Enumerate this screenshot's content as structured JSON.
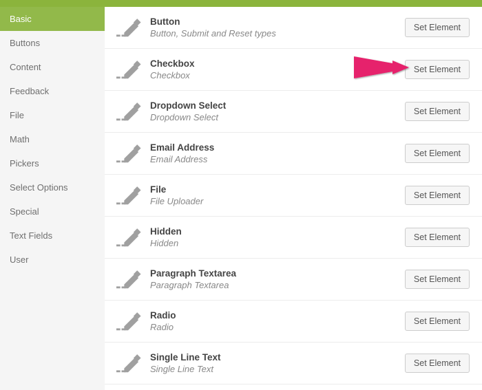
{
  "sidebar": {
    "items": [
      {
        "label": "Basic",
        "active": true
      },
      {
        "label": "Buttons",
        "active": false
      },
      {
        "label": "Content",
        "active": false
      },
      {
        "label": "Feedback",
        "active": false
      },
      {
        "label": "File",
        "active": false
      },
      {
        "label": "Math",
        "active": false
      },
      {
        "label": "Pickers",
        "active": false
      },
      {
        "label": "Select Options",
        "active": false
      },
      {
        "label": "Special",
        "active": false
      },
      {
        "label": "Text Fields",
        "active": false
      },
      {
        "label": "User",
        "active": false
      }
    ]
  },
  "elements": [
    {
      "title": "Button",
      "desc": "Button, Submit and Reset types"
    },
    {
      "title": "Checkbox",
      "desc": "Checkbox"
    },
    {
      "title": "Dropdown Select",
      "desc": "Dropdown Select"
    },
    {
      "title": "Email Address",
      "desc": "Email Address"
    },
    {
      "title": "File",
      "desc": "File Uploader"
    },
    {
      "title": "Hidden",
      "desc": "Hidden"
    },
    {
      "title": "Paragraph Textarea",
      "desc": "Paragraph Textarea"
    },
    {
      "title": "Radio",
      "desc": "Radio"
    },
    {
      "title": "Single Line Text",
      "desc": "Single Line Text"
    }
  ],
  "button_label": "Set Element",
  "colors": {
    "accent": "#92b94a",
    "annotation": "#e6246c"
  }
}
